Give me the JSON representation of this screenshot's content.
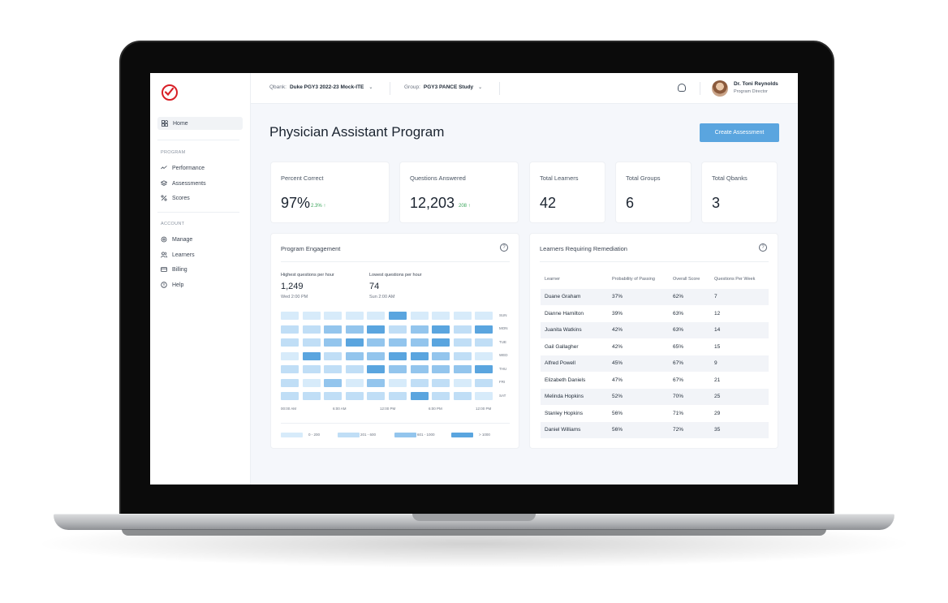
{
  "colors": {
    "brand_red": "#d81f26",
    "accent_blue": "#5aa5df",
    "positive_green": "#3aa55b",
    "heat_levels": [
      "#d7ebfa",
      "#c0def6",
      "#93c5ed",
      "#5aa5df"
    ]
  },
  "sidebar": {
    "logo_icon": "checkmark-circle-logo",
    "home": {
      "label": "Home",
      "icon": "grid-icon"
    },
    "program_section": "PROGRAM",
    "program_items": [
      {
        "label": "Performance",
        "icon": "trend-icon"
      },
      {
        "label": "Assessments",
        "icon": "layers-icon"
      },
      {
        "label": "Scores",
        "icon": "percent-icon"
      }
    ],
    "account_section": "ACCOUNT",
    "account_items": [
      {
        "label": "Manage",
        "icon": "gear-icon"
      },
      {
        "label": "Learners",
        "icon": "users-icon"
      },
      {
        "label": "Billing",
        "icon": "card-icon"
      },
      {
        "label": "Help",
        "icon": "help-icon"
      }
    ]
  },
  "topbar": {
    "qbank_key": "Qbank:",
    "qbank_value": "Duke PGY3 2022-23 Mock-ITE",
    "group_key": "Group:",
    "group_value": "PGY3 PANCE Study",
    "user_name": "Dr. Toni Reynolds",
    "user_role": "Program Director"
  },
  "header": {
    "title": "Physician Assistant Program",
    "create_button": "Create Assessment"
  },
  "stats": [
    {
      "label": "Percent Correct",
      "value": "97%",
      "delta": "2.3% ↑"
    },
    {
      "label": "Questions Answered",
      "value": "12,203",
      "delta": "208 ↑"
    },
    {
      "label": "Total Learners",
      "value": "42"
    },
    {
      "label": "Total Groups",
      "value": "6"
    },
    {
      "label": "Total Qbanks",
      "value": "3"
    }
  ],
  "engagement": {
    "title": "Program Engagement",
    "highest_label": "Highest questions per hour",
    "highest_value": "1,249",
    "highest_time": "Wed 2:00 PM",
    "lowest_label": "Lowest questions per hour",
    "lowest_value": "74",
    "lowest_time": "Sun 2:00 AM",
    "days": [
      "SUN",
      "MON",
      "TUE",
      "WED",
      "THU",
      "FRI",
      "SAT"
    ],
    "times": [
      "00:00 AM",
      "6:00 AM",
      "12:00 PM",
      "6:00 PM",
      "12:00 PM"
    ],
    "heatmap_levels": [
      [
        0,
        0,
        0,
        0,
        0,
        3,
        0,
        0,
        0,
        0
      ],
      [
        1,
        1,
        2,
        2,
        3,
        1,
        2,
        3,
        1,
        3
      ],
      [
        1,
        1,
        2,
        3,
        2,
        2,
        2,
        3,
        1,
        1
      ],
      [
        0,
        3,
        1,
        2,
        2,
        3,
        3,
        2,
        1,
        0
      ],
      [
        1,
        1,
        1,
        1,
        3,
        2,
        2,
        2,
        2,
        3
      ],
      [
        1,
        0,
        2,
        0,
        2,
        0,
        1,
        1,
        0,
        1
      ],
      [
        1,
        1,
        1,
        1,
        1,
        1,
        3,
        1,
        1,
        0
      ]
    ],
    "legend": [
      "0 - 200",
      "201 - 600",
      "601 - 1000",
      "> 1000"
    ]
  },
  "remediation": {
    "title": "Learners Requiring Remediation",
    "columns": [
      "Learner",
      "Probability of Passing",
      "Overall Score",
      "Questions Per Week"
    ],
    "rows": [
      [
        "Duane Graham",
        "37%",
        "62%",
        "7"
      ],
      [
        "Dianne Hamilton",
        "39%",
        "63%",
        "12"
      ],
      [
        "Juanita Watkins",
        "42%",
        "63%",
        "14"
      ],
      [
        "Gail Gallagher",
        "42%",
        "65%",
        "15"
      ],
      [
        "Alfred Powell",
        "45%",
        "67%",
        "9"
      ],
      [
        "Elizabeth Daniels",
        "47%",
        "67%",
        "21"
      ],
      [
        "Melinda Hopkins",
        "52%",
        "70%",
        "25"
      ],
      [
        "Stanley Hopkins",
        "56%",
        "71%",
        "29"
      ],
      [
        "Daniel Williams",
        "56%",
        "72%",
        "35"
      ]
    ]
  }
}
